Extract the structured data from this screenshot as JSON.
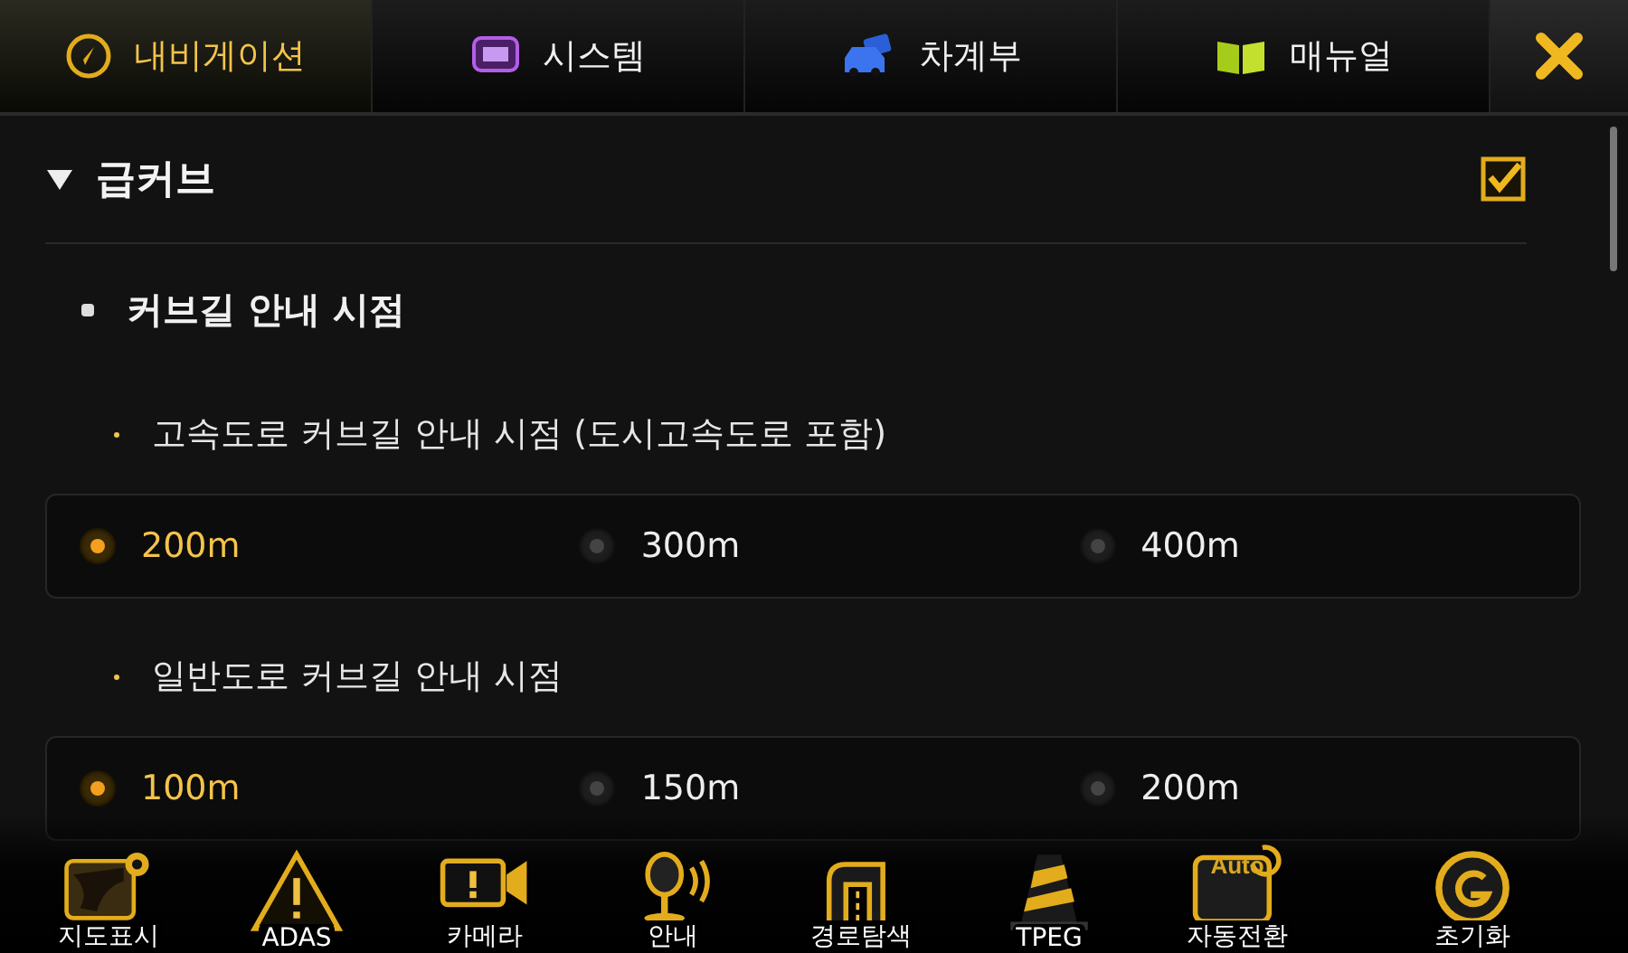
{
  "tabs": [
    {
      "label": "내비게이션",
      "selected": true
    },
    {
      "label": "시스템",
      "selected": false
    },
    {
      "label": "차계부",
      "selected": false
    },
    {
      "label": "매뉴얼",
      "selected": false
    }
  ],
  "section": {
    "title": "급커브",
    "expanded": true,
    "checked": true
  },
  "subsection": {
    "title": "커브길 안내 시점"
  },
  "groups": [
    {
      "title": "고속도로 커브길 안내 시점 (도시고속도로 포함)",
      "options": [
        {
          "label": "200m",
          "selected": true
        },
        {
          "label": "300m",
          "selected": false
        },
        {
          "label": "400m",
          "selected": false
        }
      ]
    },
    {
      "title": "일반도로 커브길 안내 시점",
      "options": [
        {
          "label": "100m",
          "selected": true
        },
        {
          "label": "150m",
          "selected": false
        },
        {
          "label": "200m",
          "selected": false
        }
      ]
    }
  ],
  "dock": [
    {
      "label": "지도표시"
    },
    {
      "label": "ADAS"
    },
    {
      "label": "카메라"
    },
    {
      "label": "안내"
    },
    {
      "label": "경로탐색"
    },
    {
      "label": "TPEG"
    },
    {
      "label": "자동전환",
      "icon_text": "Auto"
    },
    {
      "label": "초기화"
    }
  ]
}
